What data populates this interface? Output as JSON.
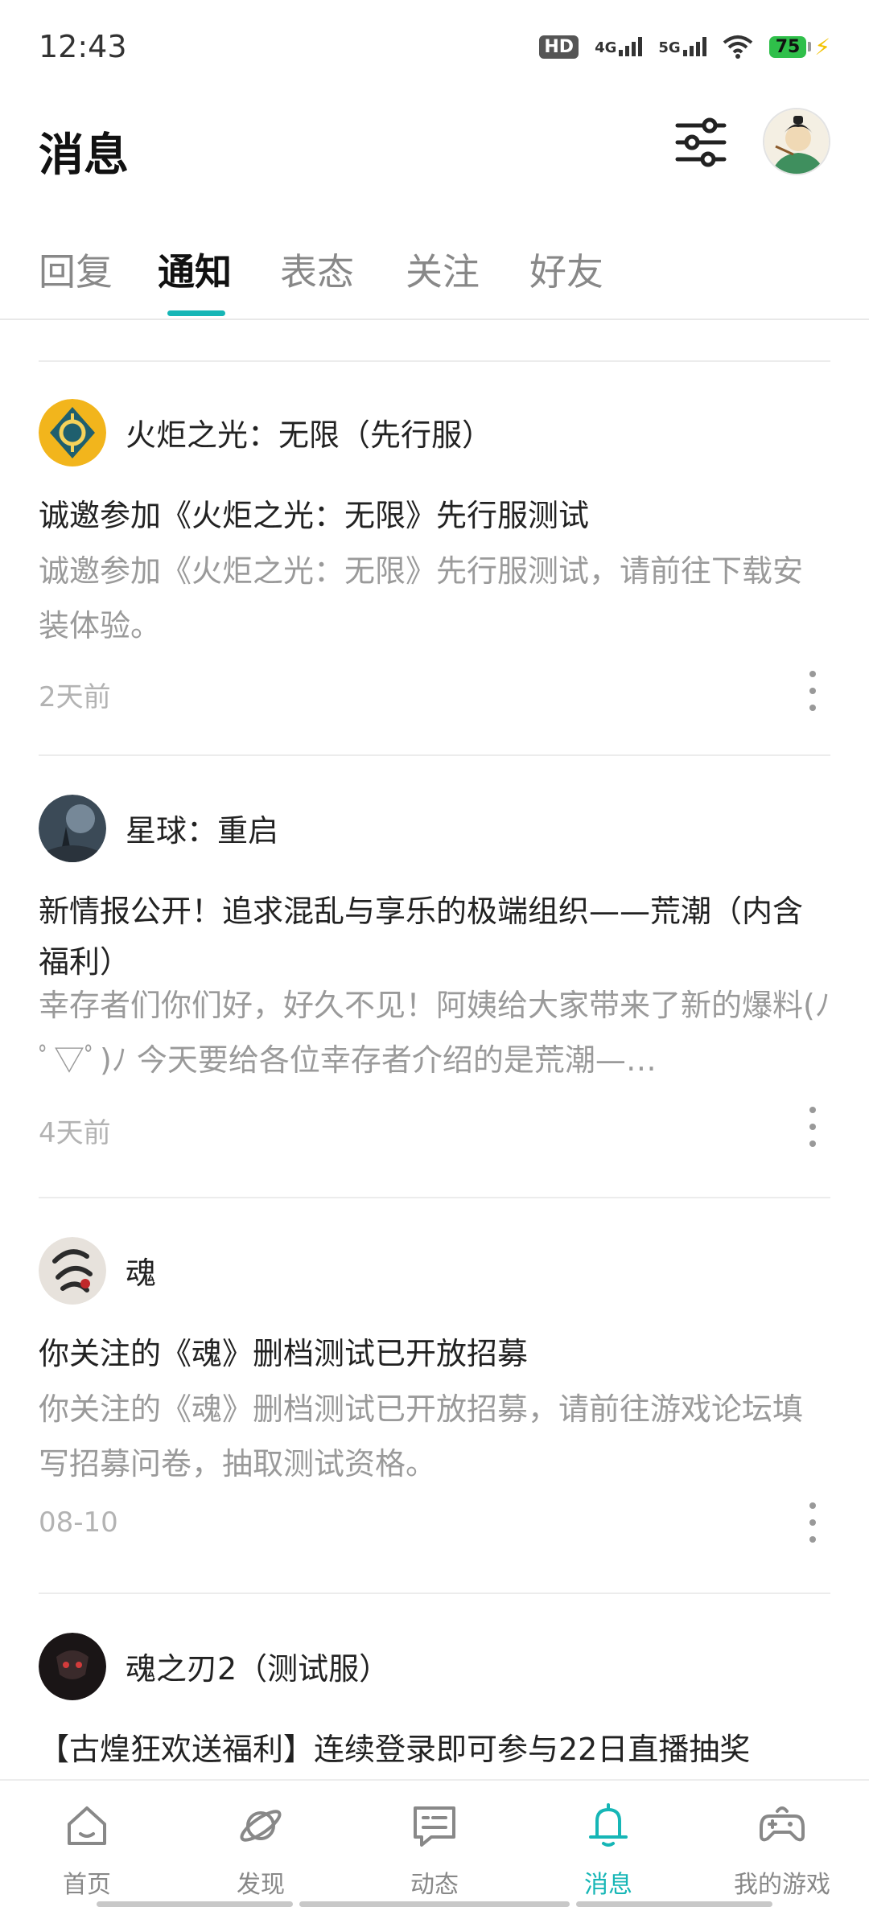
{
  "status_bar": {
    "time": "12:43",
    "hd_badge": "HD",
    "net1": "4G",
    "net2": "5G",
    "battery": "75"
  },
  "header": {
    "title": "消息",
    "filter_icon": "filter-sliders-icon"
  },
  "tabs": [
    "回复",
    "通知",
    "表态",
    "关注",
    "好友"
  ],
  "active_tab": "通知",
  "notifications": [
    {
      "sender": "火炬之光：无限（先行服）",
      "title": "诚邀参加《火炬之光：无限》先行服测试",
      "body": "诚邀参加《火炬之光：无限》先行服测试，请前往下载安装体验。",
      "time": "2天前"
    },
    {
      "sender": "星球：重启",
      "title": "新情报公开！追求混乱与享乐的极端组织——荒潮（内含福利）",
      "body": "幸存者们你们好，好久不见！阿姨给大家带来了新的爆料(ﾉ ﾟ▽ﾟ)ﾉ 今天要给各位幸存者介绍的是荒潮—…",
      "time": "4天前"
    },
    {
      "sender": "魂",
      "title": "你关注的《魂》删档测试已开放招募",
      "body": "你关注的《魂》删档测试已开放招募，请前往游戏论坛填写招募问卷，抽取测试资格。",
      "time": "08-10"
    },
    {
      "sender": "魂之刃2（测试服）",
      "title": "【古煌狂欢送福利】连续登录即可参与22日直播抽奖",
      "body": "",
      "time": ""
    }
  ],
  "bottom_nav": [
    {
      "label": "首页",
      "icon": "home-icon"
    },
    {
      "label": "发现",
      "icon": "planet-icon"
    },
    {
      "label": "动态",
      "icon": "chat-bubble-icon"
    },
    {
      "label": "消息",
      "icon": "bell-icon"
    },
    {
      "label": "我的游戏",
      "icon": "gamepad-icon"
    }
  ],
  "colors": {
    "accent": "#16b6b6",
    "inactive": "#888888",
    "muted_text": "#9a9a9a"
  }
}
